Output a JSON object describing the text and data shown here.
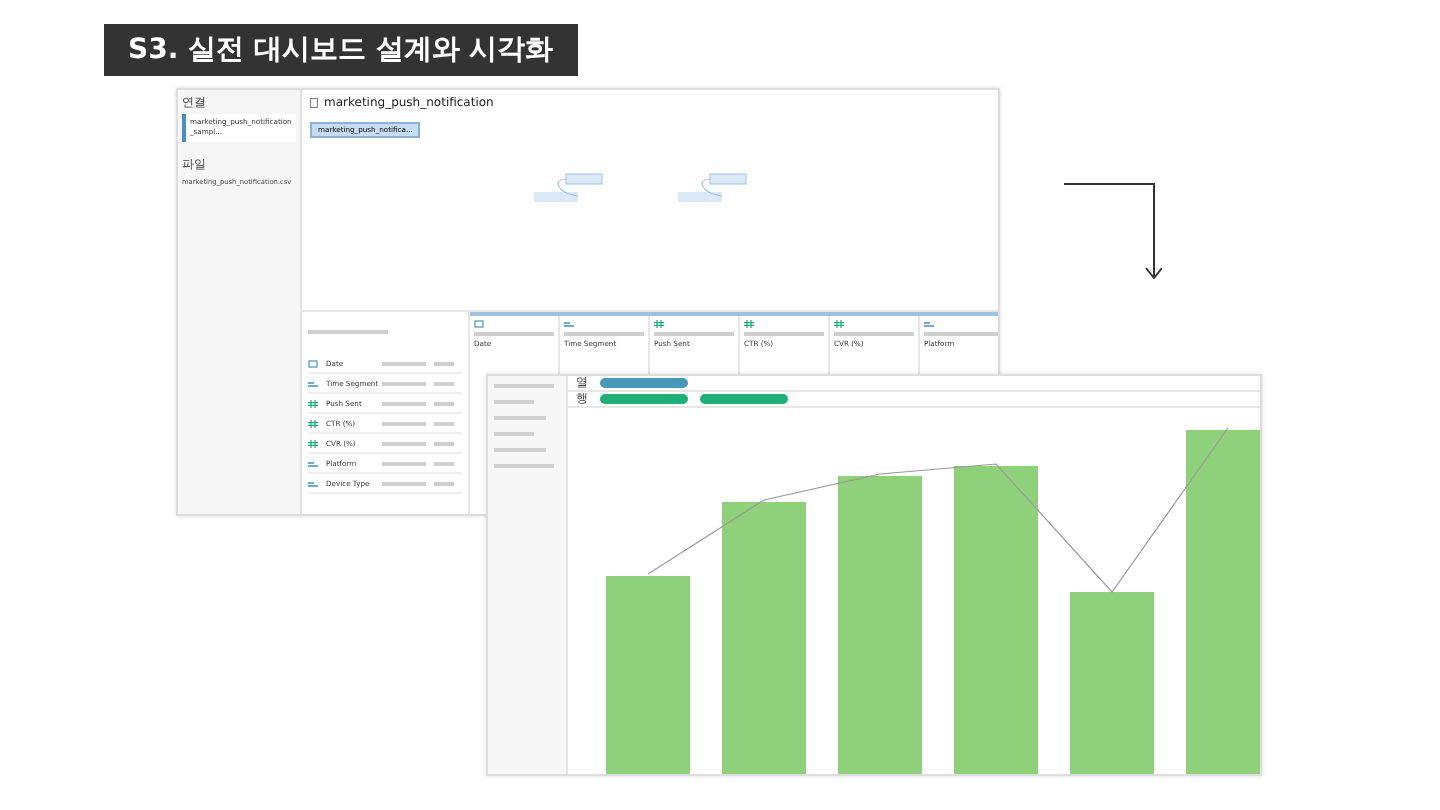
{
  "slide_title": "S3. 실전 대시보드 설계와 시각화",
  "data_source_window": {
    "sidebar": {
      "connections_label": "연결",
      "connection": "marketing_push_notification_sampl...",
      "files_label": "파일",
      "files": [
        "marketing_push_notification.csv"
      ]
    },
    "title": "marketing_push_notification",
    "table_chip": "marketing_push_notifica...",
    "grid_columns": [
      {
        "name": "Date",
        "kind": "date"
      },
      {
        "name": "Time Segment",
        "kind": "text"
      },
      {
        "name": "Push Sent",
        "kind": "number"
      },
      {
        "name": "CTR (%)",
        "kind": "number"
      },
      {
        "name": "CVR (%)",
        "kind": "number"
      },
      {
        "name": "Platform",
        "kind": "text"
      }
    ],
    "fields": [
      {
        "name": "Date",
        "kind": "date"
      },
      {
        "name": "Time Segment",
        "kind": "text"
      },
      {
        "name": "Push Sent",
        "kind": "number"
      },
      {
        "name": "CTR (%)",
        "kind": "number"
      },
      {
        "name": "CVR (%)",
        "kind": "number"
      },
      {
        "name": "Platform",
        "kind": "text"
      },
      {
        "name": "Device Type",
        "kind": "text"
      }
    ]
  },
  "worksheet_window": {
    "shelves": [
      {
        "label": "열",
        "pills": [
          {
            "kind": "dimension"
          }
        ]
      },
      {
        "label": "행",
        "pills": [
          {
            "kind": "measure"
          },
          {
            "kind": "measure"
          }
        ]
      }
    ]
  }
}
